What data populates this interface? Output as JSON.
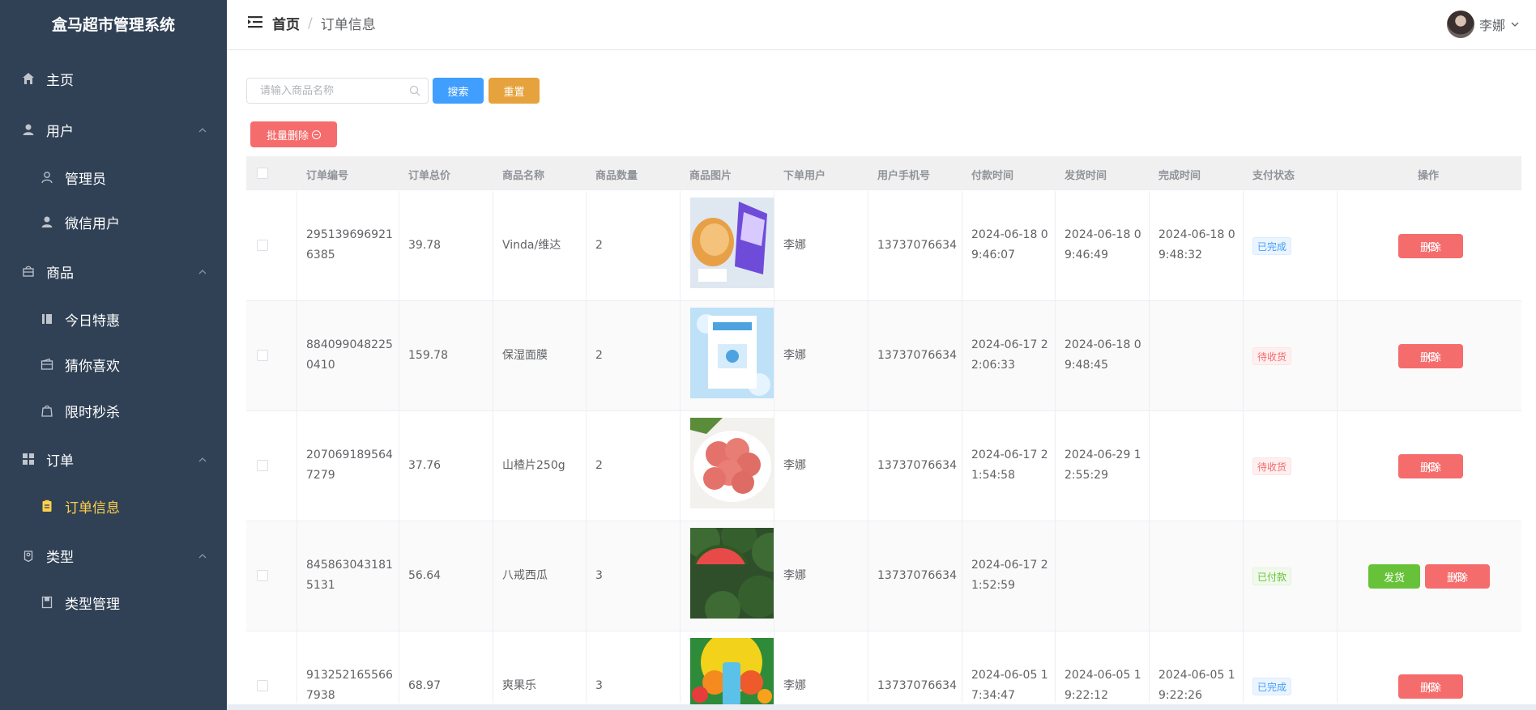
{
  "app": {
    "title": "盒马超市管理系统"
  },
  "sidebar": {
    "items": [
      {
        "label": "主页",
        "icon": "home-icon"
      },
      {
        "label": "用户",
        "icon": "user-icon"
      },
      {
        "label": "管理员",
        "icon": "user-outline-icon"
      },
      {
        "label": "微信用户",
        "icon": "user-icon"
      },
      {
        "label": "商品",
        "icon": "goods-icon"
      },
      {
        "label": "今日特惠",
        "icon": "notebook-icon"
      },
      {
        "label": "猜你喜欢",
        "icon": "wallet-icon"
      },
      {
        "label": "限时秒杀",
        "icon": "shopping-bag-icon"
      },
      {
        "label": "订单",
        "icon": "grid-icon"
      },
      {
        "label": "订单信息",
        "icon": "document-icon"
      },
      {
        "label": "类型",
        "icon": "location-icon"
      },
      {
        "label": "类型管理",
        "icon": "notebook-icon"
      }
    ],
    "active_color": "#ffd04b"
  },
  "header": {
    "breadcrumb": [
      "首页",
      "订单信息"
    ],
    "separator": "/",
    "user_name": "李娜"
  },
  "toolbar": {
    "search_placeholder": "请输入商品名称",
    "search_label": "搜索",
    "reset_label": "重置",
    "batch_delete_label": "批量删除"
  },
  "table": {
    "columns": [
      "订单编号",
      "订单总价",
      "商品名称",
      "商品数量",
      "商品图片",
      "下单用户",
      "用户手机号",
      "付款时间",
      "发货时间",
      "完成时间",
      "支付状态",
      "操作"
    ],
    "rows": [
      {
        "order_no": [
          "295139696921",
          "6385"
        ],
        "total": "39.78",
        "name": "Vinda/维达",
        "qty": "2",
        "user": "李娜",
        "phone": "13737076634",
        "paid": [
          "2024-06-18 0",
          "9:46:07"
        ],
        "shipped": [
          "2024-06-18 0",
          "9:46:49"
        ],
        "done": [
          "2024-06-18 0",
          "9:48:32"
        ],
        "status": "已完成",
        "status_color": "blue",
        "delete_label": "删除",
        "image": "tissue-bread-photo"
      },
      {
        "order_no": [
          "884099048225",
          "0410"
        ],
        "total": "159.78",
        "name": "保湿面膜",
        "qty": "2",
        "user": "李娜",
        "phone": "13737076634",
        "paid": [
          "2024-06-17 2",
          "2:06:33"
        ],
        "shipped": [
          "2024-06-18 0",
          "9:48:45"
        ],
        "done": [
          "",
          ""
        ],
        "status": "待收货",
        "status_color": "red",
        "delete_label": "删除",
        "image": "face-mask-photo"
      },
      {
        "order_no": [
          "207069189564",
          "7279"
        ],
        "total": "37.76",
        "name": "山楂片250g",
        "qty": "2",
        "user": "李娜",
        "phone": "13737076634",
        "paid": [
          "2024-06-17 2",
          "1:54:58"
        ],
        "shipped": [
          "2024-06-29 1",
          "2:55:29"
        ],
        "done": [
          "",
          ""
        ],
        "status": "待收货",
        "status_color": "red",
        "delete_label": "删除",
        "image": "hawthorn-slices-photo"
      },
      {
        "order_no": [
          "845863043181",
          "5131"
        ],
        "total": "56.64",
        "name": "八戒西瓜",
        "qty": "3",
        "user": "李娜",
        "phone": "13737076634",
        "paid": [
          "2024-06-17 2",
          "1:52:59"
        ],
        "shipped": [
          "",
          ""
        ],
        "done": [
          "",
          ""
        ],
        "status": "已付款",
        "status_color": "green",
        "ship_label": "发货",
        "delete_label": "删除",
        "image": "watermelon-photo"
      },
      {
        "order_no": [
          "913252165566",
          "7938"
        ],
        "total": "68.97",
        "name": "爽果乐",
        "qty": "3",
        "user": "李娜",
        "phone": "13737076634",
        "paid": [
          "2024-06-05 1",
          "7:34:47"
        ],
        "shipped": [
          "2024-06-05 1",
          "9:22:12"
        ],
        "done": [
          "2024-06-05 1",
          "9:22:26"
        ],
        "status": "已完成",
        "status_color": "blue",
        "delete_label": "删除",
        "image": "juice-drink-photo"
      }
    ]
  },
  "colors": {
    "sidebar_bg": "#304156",
    "primary": "#409eff",
    "warning": "#e6a23c",
    "danger": "#f56c6c",
    "success": "#67c23a"
  }
}
